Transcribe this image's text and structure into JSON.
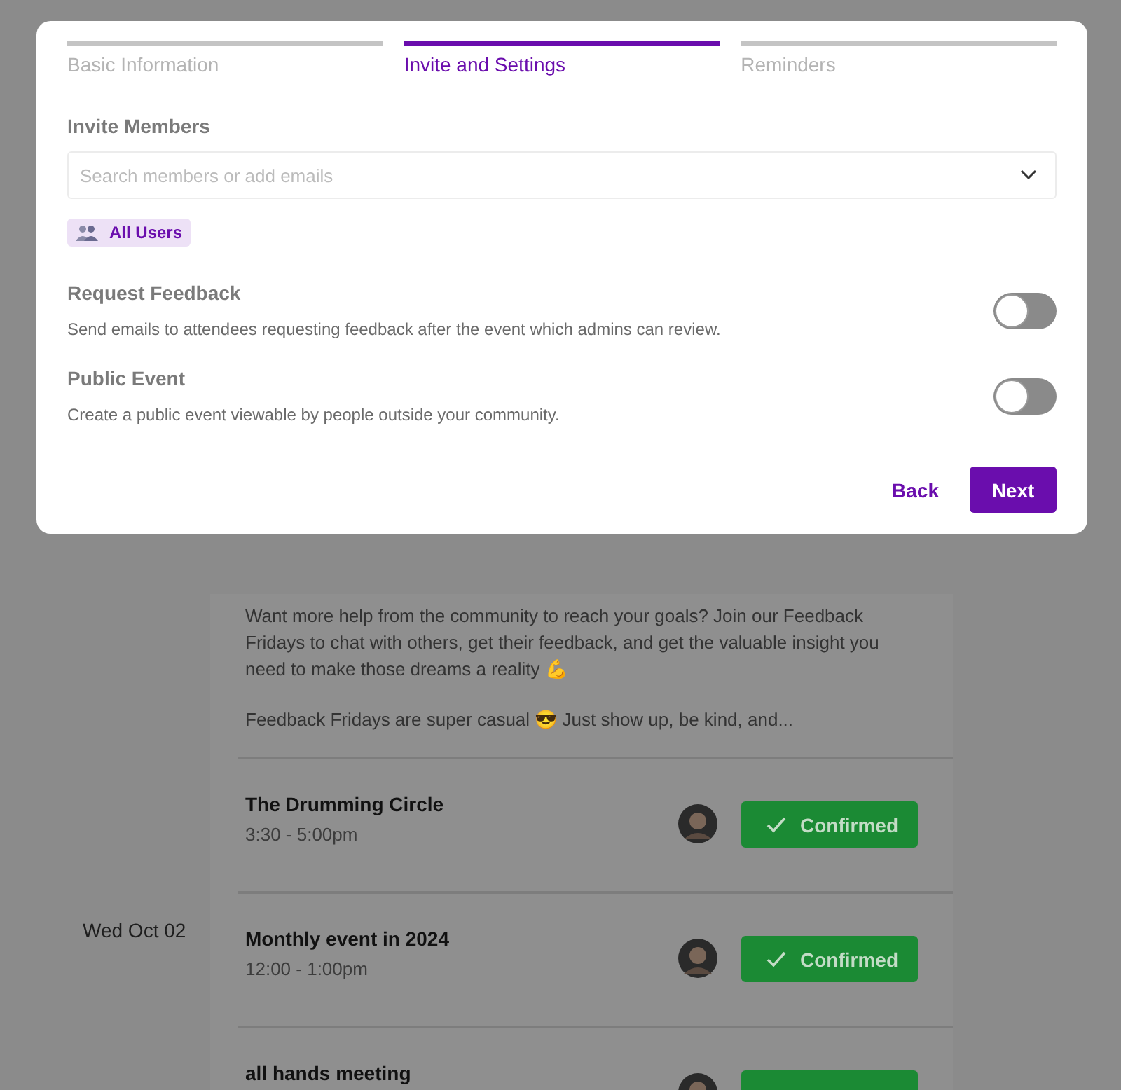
{
  "background_page": {
    "description": [
      "Want more help from the community to reach your goals? Join our Feedback Fridays to chat with others, get their feedback, and get the valuable insight you need to make those dreams a reality 💪",
      "Feedback Fridays are super casual 😎 Just show up, be kind, and..."
    ],
    "events": [
      {
        "title": "The Drumming Circle",
        "time": "3:30 - 5:00pm",
        "status": {
          "confirmed": true,
          "label": "Confirmed"
        }
      },
      {
        "date": "Wed Oct 02",
        "title": "Monthly event in 2024",
        "time": "12:00 - 1:00pm",
        "status": {
          "confirmed": true,
          "label": "Confirmed"
        }
      },
      {
        "title": "all hands meeting",
        "status": {
          "confirmed": true
        }
      }
    ]
  },
  "dialog": {
    "steps": [
      {
        "label": "Basic Information",
        "selected": false
      },
      {
        "label": "Invite and Settings",
        "selected": true
      },
      {
        "label": "Reminders",
        "selected": false
      }
    ],
    "invite": {
      "label": "Invite Members",
      "placeholder": "Search members or add emails",
      "chips": [
        {
          "label": "All Users"
        }
      ]
    },
    "settings": [
      {
        "title": "Request Feedback",
        "description": "Send emails to attendees requesting feedback after the event which admins can review.",
        "on": false
      },
      {
        "title": "Public Event",
        "description": "Create a public event viewable by people outside your community.",
        "on": false
      }
    ],
    "buttons": {
      "back": "Back",
      "next": "Next"
    }
  }
}
